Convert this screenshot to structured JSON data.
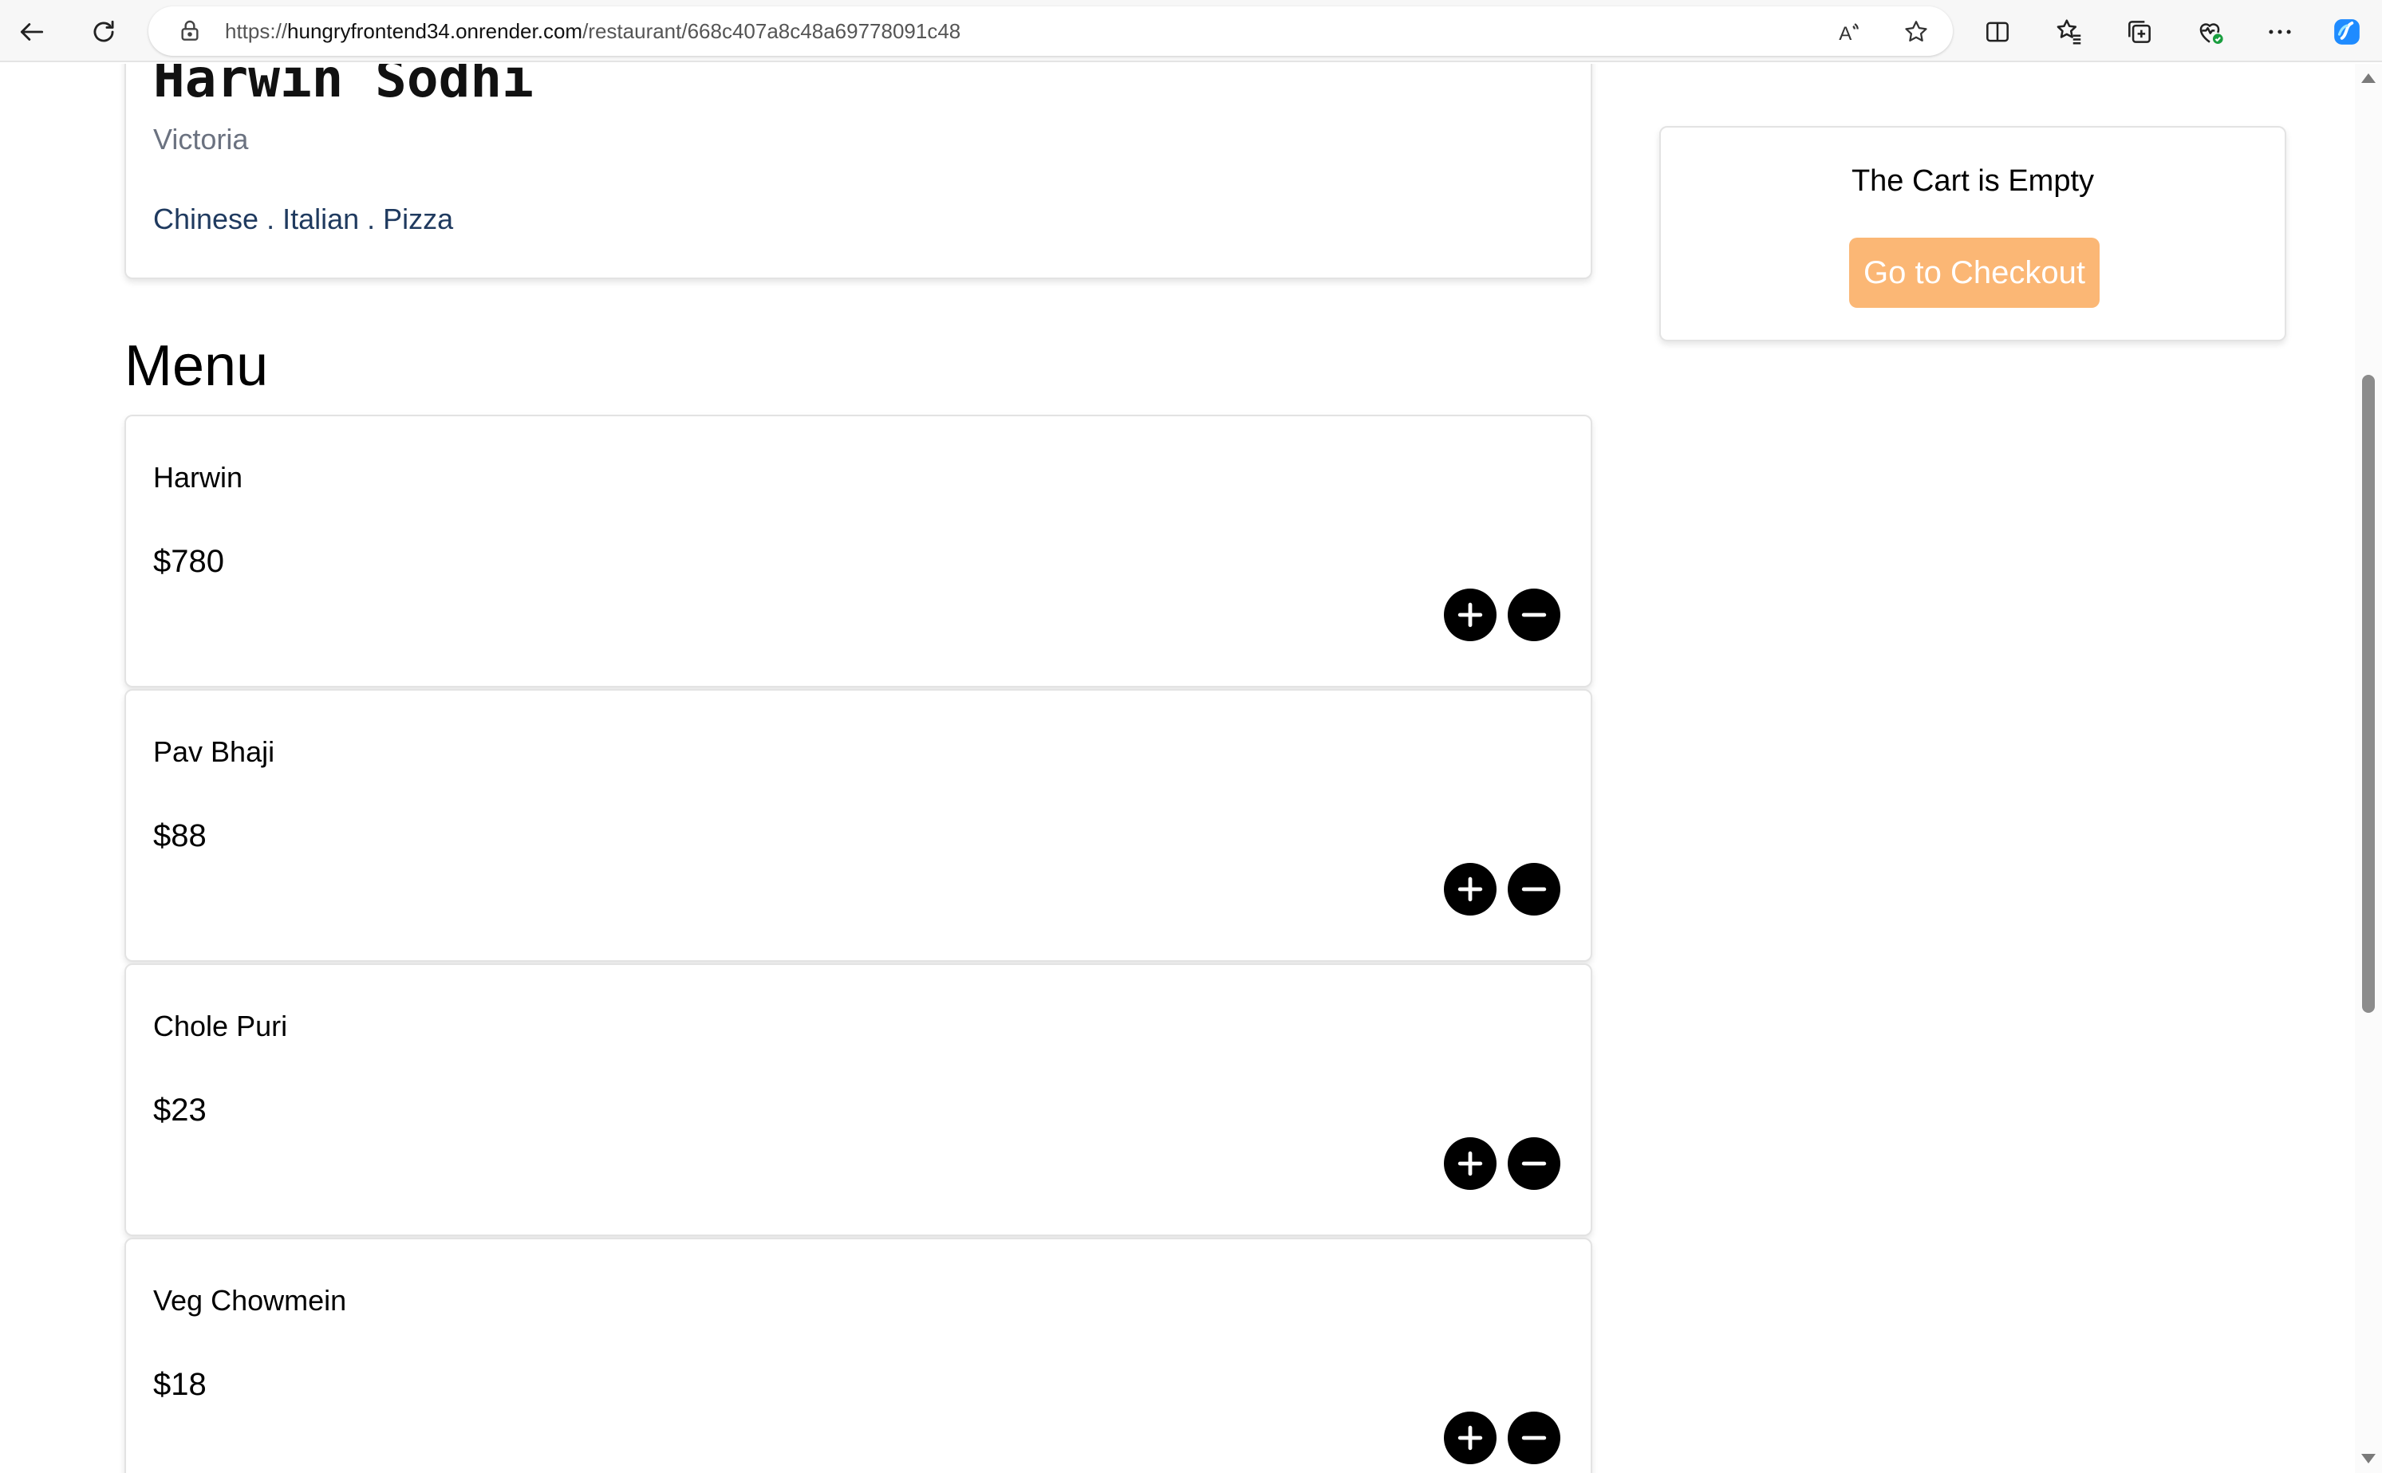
{
  "browser": {
    "url_prefix": "https://",
    "url_host": "hungryfrontend34.onrender.com",
    "url_path": "/restaurant/668c407a8c48a69778091c48",
    "read_aloud_label": "A"
  },
  "restaurant": {
    "name": "Harwin Sodhi",
    "city": "Victoria",
    "cuisines": "Chinese . Italian . Pizza"
  },
  "menu": {
    "title": "Menu",
    "items": [
      {
        "name": "Harwin",
        "price": "$780"
      },
      {
        "name": "Pav Bhaji",
        "price": "$88"
      },
      {
        "name": "Chole Puri",
        "price": "$23"
      },
      {
        "name": "Veg Chowmein",
        "price": "$18"
      }
    ]
  },
  "cart": {
    "empty_text": "The Cart is Empty",
    "checkout_label": "Go to Checkout",
    "checkout_color": "#fbb775"
  },
  "icons": {
    "add": "plus-icon",
    "remove": "minus-icon"
  }
}
